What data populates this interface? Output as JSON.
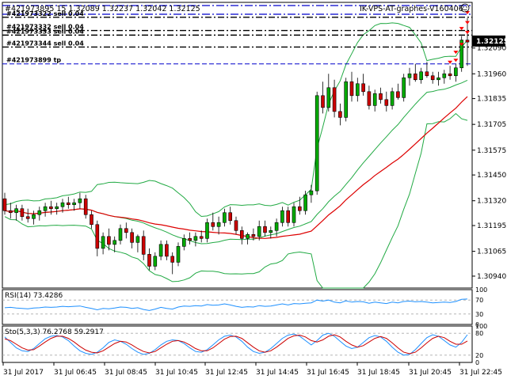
{
  "header": {
    "symbol_info": "#421973895 15  1.32089 1.32237 1.32042 1.32125",
    "expert_label": "IK-VPS-AT-graphes-V160406",
    "smile_icon": "smile-icon"
  },
  "order_labels": [
    {
      "text": "#421973322 sell 0.04",
      "price": 1.32245
    },
    {
      "text": "#421973332 sell 0.04",
      "price": 1.32178
    },
    {
      "text": "#421973333 sell 0.04",
      "price": 1.32155
    },
    {
      "text": "#421973344 sell 0.04",
      "price": 1.32095
    },
    {
      "text": "#421973899 tp",
      "price": 1.3201
    }
  ],
  "price_tag": {
    "value": "1.32125",
    "price": 1.32125
  },
  "colors": {
    "bull": "#00aa00",
    "bear": "#cc0000",
    "bands": "#22aa44",
    "ma": "#dd0000",
    "rsi": "#1e90ff",
    "sto_main": "#1e90ff",
    "sto_signal": "#cc0000",
    "order_line": "#0000cc"
  },
  "chart_data": [
    {
      "type": "candlestick",
      "symbol": "GBPUSD",
      "timeframe": "M15",
      "ylim": [
        1.3088,
        1.3232
      ],
      "y_ticks": [
        "1.32090",
        "1.31960",
        "1.31835",
        "1.31705",
        "1.31575",
        "1.31450",
        "1.31320",
        "1.31195",
        "1.31065",
        "1.30940"
      ],
      "y_tick_values": [
        1.3209,
        1.3196,
        1.31835,
        1.31705,
        1.31575,
        1.3145,
        1.3132,
        1.31195,
        1.31065,
        1.3094
      ],
      "x_ticks": [
        "31 Jul 2017",
        "31 Jul 06:45",
        "31 Jul 08:45",
        "31 Jul 10:45",
        "31 Jul 12:45",
        "31 Jul 14:45",
        "31 Jul 16:45",
        "31 Jul 18:45",
        "31 Jul 20:45",
        "31 Jul 22:45"
      ],
      "candles": [
        [
          1.3133,
          1.3136,
          1.3125,
          1.3127
        ],
        [
          1.3127,
          1.3131,
          1.3123,
          1.3126
        ],
        [
          1.3126,
          1.313,
          1.3122,
          1.3128
        ],
        [
          1.3128,
          1.313,
          1.3122,
          1.3124
        ],
        [
          1.3124,
          1.3128,
          1.3121,
          1.3123
        ],
        [
          1.3123,
          1.3127,
          1.312,
          1.3125
        ],
        [
          1.3125,
          1.3129,
          1.3122,
          1.3127
        ],
        [
          1.3127,
          1.3131,
          1.3124,
          1.3129
        ],
        [
          1.3129,
          1.3132,
          1.3125,
          1.3128
        ],
        [
          1.3128,
          1.3131,
          1.3125,
          1.3129
        ],
        [
          1.3129,
          1.3133,
          1.3126,
          1.3131
        ],
        [
          1.3131,
          1.3134,
          1.3128,
          1.313
        ],
        [
          1.313,
          1.3133,
          1.3127,
          1.3131
        ],
        [
          1.3131,
          1.3136,
          1.3128,
          1.3133
        ],
        [
          1.3133,
          1.3135,
          1.3123,
          1.3125
        ],
        [
          1.3125,
          1.3127,
          1.3118,
          1.312
        ],
        [
          1.312,
          1.3122,
          1.3104,
          1.3108
        ],
        [
          1.3108,
          1.3116,
          1.3105,
          1.3114
        ],
        [
          1.3114,
          1.3118,
          1.3107,
          1.311
        ],
        [
          1.311,
          1.3114,
          1.3106,
          1.3112
        ],
        [
          1.3112,
          1.312,
          1.311,
          1.3118
        ],
        [
          1.3118,
          1.3121,
          1.3113,
          1.3116
        ],
        [
          1.3116,
          1.3118,
          1.3108,
          1.3111
        ],
        [
          1.3111,
          1.3115,
          1.3106,
          1.3114
        ],
        [
          1.3114,
          1.3117,
          1.3102,
          1.3105
        ],
        [
          1.3105,
          1.3108,
          1.3097,
          1.3099
        ],
        [
          1.3099,
          1.3106,
          1.3097,
          1.3104
        ],
        [
          1.3104,
          1.3112,
          1.3102,
          1.311
        ],
        [
          1.311,
          1.3112,
          1.3102,
          1.3104
        ],
        [
          1.3104,
          1.3106,
          1.3095,
          1.3101
        ],
        [
          1.3101,
          1.3111,
          1.3099,
          1.3109
        ],
        [
          1.3109,
          1.3115,
          1.3107,
          1.3113
        ],
        [
          1.3113,
          1.3116,
          1.311,
          1.3112
        ],
        [
          1.3112,
          1.3116,
          1.3109,
          1.3114
        ],
        [
          1.3114,
          1.3117,
          1.3111,
          1.3113
        ],
        [
          1.3113,
          1.3123,
          1.3111,
          1.3121
        ],
        [
          1.3121,
          1.3126,
          1.3117,
          1.3119
        ],
        [
          1.3119,
          1.3124,
          1.3115,
          1.3121
        ],
        [
          1.3121,
          1.3128,
          1.3119,
          1.3126
        ],
        [
          1.3126,
          1.3129,
          1.312,
          1.3122
        ],
        [
          1.3122,
          1.3124,
          1.3115,
          1.3117
        ],
        [
          1.3117,
          1.3119,
          1.311,
          1.3113
        ],
        [
          1.3113,
          1.3116,
          1.311,
          1.3115
        ],
        [
          1.3115,
          1.3118,
          1.3112,
          1.3114
        ],
        [
          1.3114,
          1.3122,
          1.3112,
          1.3119
        ],
        [
          1.3119,
          1.3122,
          1.3114,
          1.3116
        ],
        [
          1.3116,
          1.3119,
          1.3113,
          1.3117
        ],
        [
          1.3117,
          1.3123,
          1.3114,
          1.3121
        ],
        [
          1.3121,
          1.3129,
          1.3119,
          1.3127
        ],
        [
          1.3127,
          1.3129,
          1.3119,
          1.3121
        ],
        [
          1.3121,
          1.3131,
          1.3119,
          1.3129
        ],
        [
          1.3129,
          1.3134,
          1.3125,
          1.3127
        ],
        [
          1.3127,
          1.3137,
          1.3125,
          1.3135
        ],
        [
          1.3135,
          1.314,
          1.3131,
          1.3137
        ],
        [
          1.3137,
          1.3187,
          1.3135,
          1.3185
        ],
        [
          1.3185,
          1.3192,
          1.3176,
          1.3179
        ],
        [
          1.3179,
          1.3196,
          1.3177,
          1.3189
        ],
        [
          1.3189,
          1.3193,
          1.3174,
          1.3177
        ],
        [
          1.3177,
          1.3181,
          1.317,
          1.3174
        ],
        [
          1.3174,
          1.3194,
          1.3172,
          1.3192
        ],
        [
          1.3192,
          1.3197,
          1.3182,
          1.3185
        ],
        [
          1.3185,
          1.3194,
          1.3182,
          1.3191
        ],
        [
          1.3191,
          1.3196,
          1.3185,
          1.3187
        ],
        [
          1.3187,
          1.319,
          1.3178,
          1.318
        ],
        [
          1.318,
          1.3188,
          1.3177,
          1.3186
        ],
        [
          1.3186,
          1.3189,
          1.3181,
          1.3183
        ],
        [
          1.3183,
          1.3187,
          1.3177,
          1.318
        ],
        [
          1.318,
          1.3189,
          1.3178,
          1.3187
        ],
        [
          1.3187,
          1.3191,
          1.3183,
          1.3184
        ],
        [
          1.3184,
          1.3196,
          1.3182,
          1.3194
        ],
        [
          1.3194,
          1.3199,
          1.319,
          1.3196
        ],
        [
          1.3196,
          1.3201,
          1.3192,
          1.3193
        ],
        [
          1.3193,
          1.3199,
          1.3191,
          1.3197
        ],
        [
          1.3197,
          1.3202,
          1.3194,
          1.3195
        ],
        [
          1.3195,
          1.3197,
          1.3191,
          1.3193
        ],
        [
          1.3193,
          1.3197,
          1.319,
          1.3194
        ],
        [
          1.3194,
          1.3198,
          1.3191,
          1.3196
        ],
        [
          1.3196,
          1.32,
          1.3193,
          1.3195
        ],
        [
          1.3195,
          1.3201,
          1.3192,
          1.3199
        ],
        [
          1.3199,
          1.3215,
          1.3197,
          1.3213
        ],
        [
          1.3213,
          1.3224,
          1.32,
          1.3212
        ]
      ]
    },
    {
      "type": "line",
      "title": "RSI(14) 73.4286",
      "indicator": "RSI",
      "ylim": [
        0,
        100
      ],
      "y_ticks": [
        "100",
        "70",
        "30",
        "0"
      ],
      "levels": [
        70,
        30
      ],
      "values": [
        48,
        49,
        47,
        46,
        45,
        47,
        48,
        50,
        49,
        50,
        52,
        51,
        52,
        53,
        49,
        46,
        42,
        46,
        45,
        47,
        50,
        49,
        46,
        48,
        43,
        40,
        44,
        49,
        46,
        44,
        50,
        53,
        52,
        54,
        53,
        57,
        55,
        56,
        59,
        56,
        52,
        49,
        51,
        50,
        54,
        52,
        53,
        56,
        59,
        56,
        60,
        59,
        61,
        62,
        70,
        67,
        70,
        64,
        62,
        68,
        64,
        66,
        65,
        61,
        64,
        62,
        60,
        64,
        62,
        66,
        67,
        65,
        66,
        64,
        62,
        63,
        64,
        63,
        66,
        72,
        73
      ]
    },
    {
      "type": "line",
      "title": "Sto(5,3,3) 76.2768 59.2917",
      "indicator": "Stochastic",
      "ylim": [
        0,
        100
      ],
      "y_ticks": [
        "100",
        "80",
        "20",
        "0"
      ],
      "levels": [
        80,
        20
      ],
      "series": [
        {
          "values": [
            70,
            55,
            40,
            32,
            30,
            38,
            52,
            65,
            72,
            74,
            70,
            60,
            45,
            32,
            25,
            22,
            28,
            40,
            55,
            62,
            58,
            50,
            38,
            28,
            22,
            25,
            35,
            48,
            58,
            62,
            60,
            52,
            40,
            30,
            28,
            35,
            48,
            62,
            72,
            75,
            70,
            58,
            42,
            30,
            25,
            28,
            38,
            52,
            66,
            75,
            78,
            72,
            60,
            48,
            60,
            75,
            80,
            72,
            58,
            45,
            38,
            42,
            55,
            68,
            74,
            70,
            58,
            42,
            28,
            20,
            22,
            35,
            52,
            68,
            76,
            72,
            60,
            48,
            42,
            55,
            76
          ]
        },
        {
          "values": [
            65,
            60,
            50,
            40,
            34,
            35,
            45,
            56,
            66,
            72,
            72,
            66,
            56,
            44,
            34,
            28,
            26,
            32,
            42,
            52,
            58,
            56,
            48,
            38,
            30,
            26,
            30,
            40,
            50,
            58,
            60,
            56,
            48,
            38,
            32,
            32,
            40,
            52,
            64,
            71,
            72,
            66,
            54,
            42,
            32,
            28,
            32,
            42,
            54,
            66,
            73,
            75,
            70,
            60,
            56,
            62,
            72,
            76,
            70,
            58,
            48,
            42,
            46,
            56,
            66,
            71,
            66,
            54,
            40,
            28,
            24,
            28,
            40,
            54,
            66,
            72,
            68,
            58,
            50,
            50,
            59
          ]
        }
      ]
    }
  ]
}
